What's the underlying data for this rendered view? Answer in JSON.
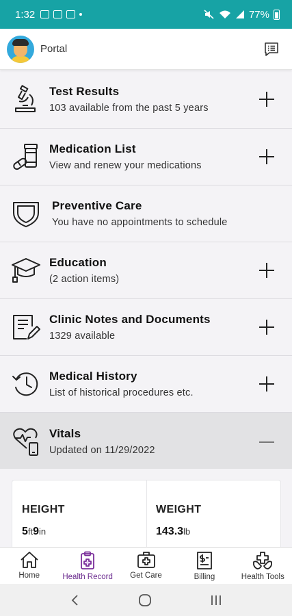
{
  "status_bar": {
    "time": "1:32",
    "battery": "77%"
  },
  "app_bar": {
    "title": "Portal",
    "icons": [
      "avatar",
      "message-list-icon"
    ]
  },
  "rows": [
    {
      "title": "Test Results",
      "subtitle": "103 available from the past 5 years",
      "icon": "microscope-icon",
      "action": "expand"
    },
    {
      "title": "Medication List",
      "subtitle": "View and renew your medications",
      "icon": "medication-icon",
      "action": "expand"
    },
    {
      "title": "Preventive Care",
      "subtitle": "You have no appointments to schedule",
      "icon": "shield-icon",
      "action": "none"
    },
    {
      "title": "Education",
      "subtitle": "(2 action items)",
      "icon": "graduation-cap-icon",
      "action": "expand"
    },
    {
      "title": "Clinic Notes and Documents",
      "subtitle": "1329 available",
      "icon": "document-edit-icon",
      "action": "expand"
    },
    {
      "title": "Medical History",
      "subtitle": "List of historical procedures etc.",
      "icon": "history-clock-icon",
      "action": "expand"
    },
    {
      "title": "Vitals",
      "subtitle": "Updated on 11/29/2022",
      "icon": "heart-phone-icon",
      "action": "collapse"
    }
  ],
  "vitals": {
    "height": {
      "label": "HEIGHT",
      "feet": "5",
      "feet_unit": "ft",
      "inches": "9",
      "inches_unit": "in"
    },
    "weight": {
      "label": "WEIGHT",
      "value": "143.3",
      "unit": "lb"
    }
  },
  "tabs": [
    {
      "label": "Home",
      "icon": "home-icon",
      "active": false
    },
    {
      "label": "Health Record",
      "icon": "health-record-icon",
      "active": true
    },
    {
      "label": "Get Care",
      "icon": "medical-kit-icon",
      "active": false
    },
    {
      "label": "Billing",
      "icon": "billing-icon",
      "active": false
    },
    {
      "label": "Health Tools",
      "icon": "health-tools-icon",
      "active": false
    }
  ],
  "colors": {
    "status_bar": "#17a3a5",
    "active_tab": "#6a2a8e",
    "vitals_row": "#e2e2e4"
  }
}
